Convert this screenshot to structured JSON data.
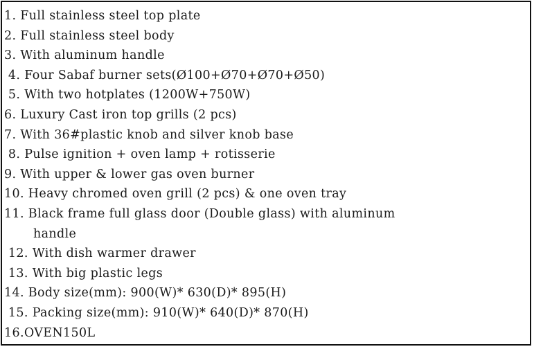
{
  "document": {
    "kind": "product-specification-list",
    "border_color": "#111111",
    "background_color": "#ffffff",
    "text_color": "#1a1a1a",
    "line_count": 17,
    "lines": [
      {
        "id": "item-1",
        "text": "1. Full stainless steel top plate",
        "continuation": false
      },
      {
        "id": "item-2",
        "text": "2. Full stainless steel body",
        "continuation": false
      },
      {
        "id": "item-3",
        "text": "3. With aluminum handle",
        "continuation": false
      },
      {
        "id": "item-4",
        "text": " 4. Four Sabaf burner sets(Ø100+Ø70+Ø70+Ø50)",
        "continuation": false
      },
      {
        "id": "item-5",
        "text": " 5. With two hotplates (1200W+750W)",
        "continuation": false
      },
      {
        "id": "item-6",
        "text": "6. Luxury Cast iron top grills (2 pcs)",
        "continuation": false
      },
      {
        "id": "item-7",
        "text": "7. With 36#plastic knob and silver knob base",
        "continuation": false
      },
      {
        "id": "item-8",
        "text": " 8. Pulse ignition + oven lamp + rotisserie",
        "continuation": false
      },
      {
        "id": "item-9",
        "text": "9. With upper & lower gas oven burner",
        "continuation": false
      },
      {
        "id": "item-10",
        "text": "10. Heavy chromed oven grill (2 pcs) & one oven tray",
        "continuation": false
      },
      {
        "id": "item-11",
        "text": "11. Black frame full glass door (Double glass) with aluminum",
        "continuation": false
      },
      {
        "id": "item-11-wrap",
        "text": "handle",
        "continuation": true
      },
      {
        "id": "item-12",
        "text": " 12. With dish warmer drawer",
        "continuation": false
      },
      {
        "id": "item-13",
        "text": " 13. With big plastic legs",
        "continuation": false
      },
      {
        "id": "item-14",
        "text": "14. Body size(mm): 900(W)* 630(D)* 895(H)",
        "continuation": false
      },
      {
        "id": "item-15",
        "text": " 15. Packing size(mm): 910(W)* 640(D)* 870(H)",
        "continuation": false
      },
      {
        "id": "item-16",
        "text": "16.OVEN150L",
        "continuation": false
      }
    ],
    "values": {
      "burner_sets": "Ø100+Ø70+Ø70+Ø50",
      "burner_count": "Four",
      "hotplate_count": "two",
      "hotplate_power": "1200W+750W",
      "top_grills_pcs": "2 pcs",
      "knob_type": "36#plastic",
      "oven_grill_pcs": "2 pcs",
      "oven_tray_count": "one",
      "body_size_mm": "900(W)* 630(D)* 895(H)",
      "body_width_mm": "900",
      "body_depth_mm": "630",
      "body_height_mm": "895",
      "packing_size_mm": "910(W)* 640(D)* 870(H)",
      "packing_width_mm": "910",
      "packing_depth_mm": "640",
      "packing_height_mm": "870",
      "model": "OVEN150L"
    }
  }
}
